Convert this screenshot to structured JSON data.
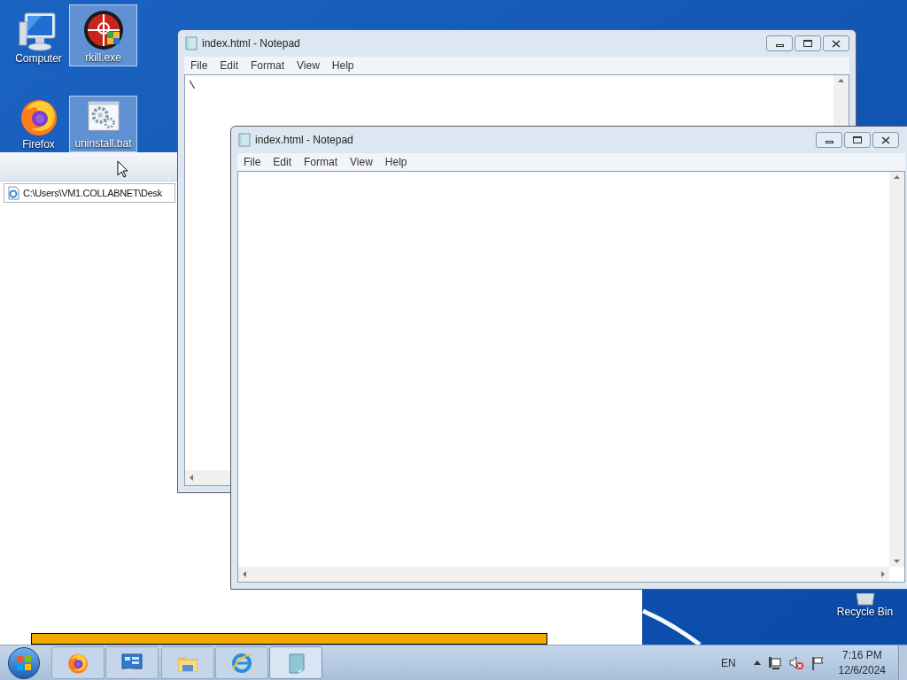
{
  "desktop_icons": [
    {
      "kind": "computer",
      "label": "Computer",
      "selected": false
    },
    {
      "kind": "rkill",
      "label": "rkill.exe",
      "selected": true
    },
    {
      "kind": "firefox",
      "label": "Firefox",
      "selected": false
    },
    {
      "kind": "batch",
      "label": "uninstall.bat",
      "selected": true
    },
    {
      "kind": "recycle",
      "label": "Recycle Bin",
      "selected": false
    }
  ],
  "explorer_window": {
    "address": "C:\\Users\\VM1.COLLABNET\\Desk"
  },
  "progress": {
    "level": 1
  },
  "notepad_windows": [
    {
      "title": "index.html - Notepad",
      "menu": [
        "File",
        "Edit",
        "Format",
        "View",
        "Help"
      ],
      "content": "\\"
    },
    {
      "title": "index.html - Notepad",
      "menu": [
        "File",
        "Edit",
        "Format",
        "View",
        "Help"
      ]
    }
  ],
  "taskbar": {
    "apps": [
      {
        "kind": "firefox",
        "selected": false
      },
      {
        "kind": "control-panel",
        "selected": false
      },
      {
        "kind": "folder",
        "selected": false
      },
      {
        "kind": "browser",
        "selected": false
      },
      {
        "kind": "notepad",
        "selected": true
      }
    ],
    "tray": {
      "language": "EN",
      "time": "7:16 PM",
      "date": "12/6/2024"
    }
  }
}
